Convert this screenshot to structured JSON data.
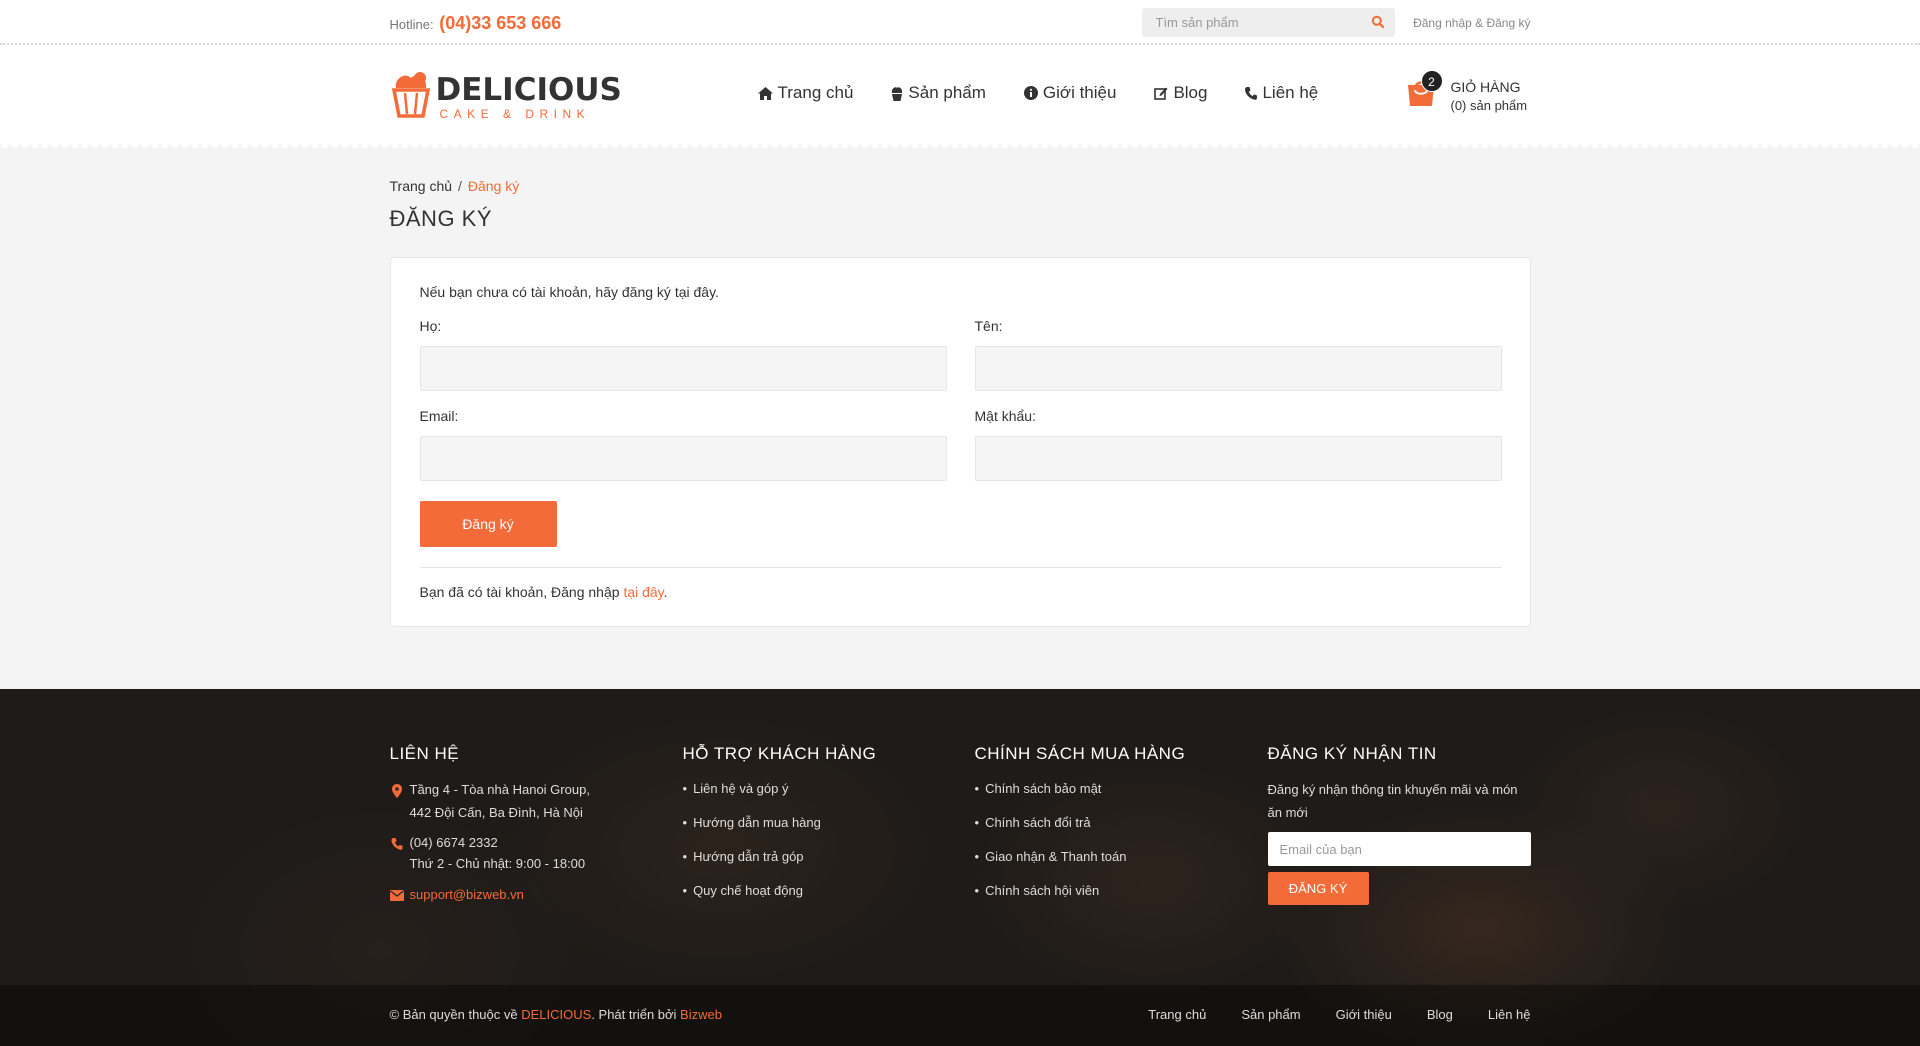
{
  "topbar": {
    "hotline_label": "Hotline:",
    "hotline_number": "(04)33 653 666",
    "search_placeholder": "Tìm sản phẩm",
    "auth_link": "Đăng nhập & Đăng ký"
  },
  "header": {
    "brand": "DELICIOUS",
    "tagline": "CAKE & DRINK",
    "nav": [
      {
        "label": "Trang chủ",
        "icon": "home-icon"
      },
      {
        "label": "Sản phẩm",
        "icon": "cupcake-icon"
      },
      {
        "label": "Giới thiệu",
        "icon": "info-icon"
      },
      {
        "label": "Blog",
        "icon": "edit-icon"
      },
      {
        "label": "Liên hệ",
        "icon": "phone-icon"
      }
    ],
    "cart": {
      "badge": "2",
      "title": "GIỎ HÀNG",
      "count": "(0) sản phẩm"
    }
  },
  "breadcrumb": {
    "home": "Trang chủ",
    "separator": "/",
    "current": "Đăng ký"
  },
  "page": {
    "title": "ĐĂNG KÝ",
    "intro": "Nếu bạn chưa có tài khoản, hãy đăng ký tại đây.",
    "fields": {
      "ho": {
        "label": "Họ:",
        "value": ""
      },
      "ten": {
        "label": "Tên:",
        "value": ""
      },
      "email": {
        "label": "Email:",
        "value": ""
      },
      "password": {
        "label": "Mật khẩu:",
        "value": ""
      }
    },
    "submit_label": "Đăng ký",
    "login_prefix": "Bạn đã có tài khoản, Đăng nhập ",
    "login_link": "tại đây",
    "login_suffix": "."
  },
  "footer": {
    "contact": {
      "heading": "LIÊN HỆ",
      "address_line1": "Tầng 4 - Tòa nhà Hanoi Group,",
      "address_line2": "442 Đội Cấn, Ba Đình, Hà Nội",
      "phone": "(04) 6674 2332",
      "hours": "Thứ 2 - Chủ nhật: 9:00 - 18:00",
      "email": "support@bizweb.vn"
    },
    "support": {
      "heading": "HỖ TRỢ KHÁCH HÀNG",
      "items": [
        "Liên hệ và góp ý",
        "Hướng dẫn mua hàng",
        "Hướng dẫn trả góp",
        "Quy chế hoạt động"
      ]
    },
    "policy": {
      "heading": "CHÍNH SÁCH MUA HÀNG",
      "items": [
        "Chính sách bảo mật",
        "Chính sách đổi trả",
        "Giao nhận & Thanh toán",
        "Chính sách hội viên"
      ]
    },
    "newsletter": {
      "heading": "ĐĂNG KÝ NHẬN TIN",
      "text": "Đăng ký nhận thông tin khuyến mãi và món ăn mới",
      "placeholder": "Email của bạn",
      "button": "ĐĂNG KÝ"
    },
    "bottom": {
      "copy_prefix": "© Bản quyền thuộc về ",
      "brand": "DELICIOUS",
      "copy_middle": ". Phát triển bởi ",
      "developer": "Bizweb",
      "links": [
        "Trang chủ",
        "Sản phẩm",
        "Giới thiệu",
        "Blog",
        "Liên hệ"
      ]
    }
  },
  "colors": {
    "accent": "#f26b38",
    "footer_bg": "#2b2623"
  }
}
